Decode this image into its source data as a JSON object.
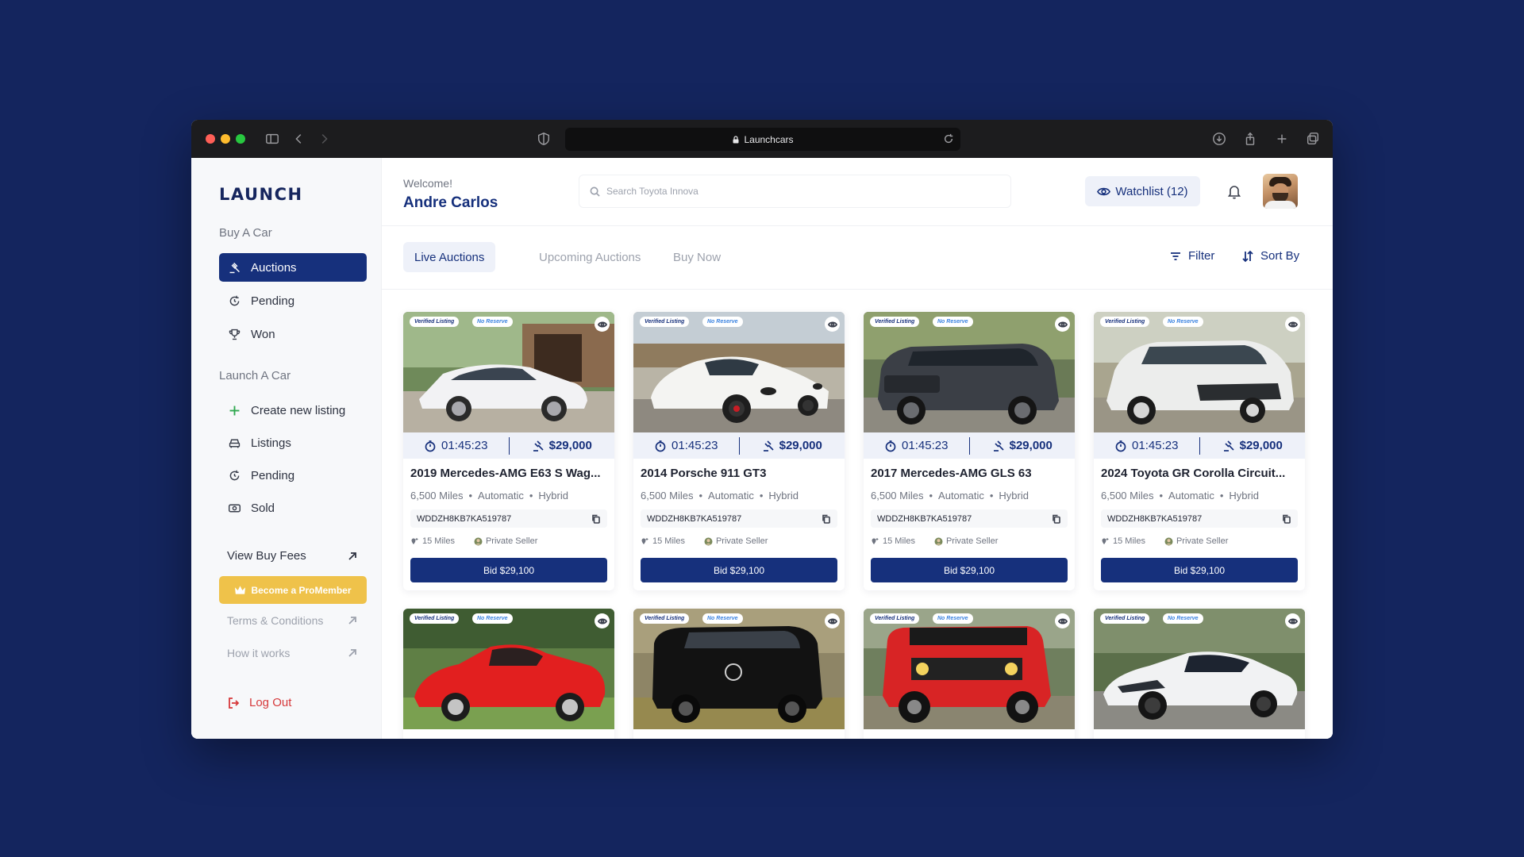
{
  "browser": {
    "url_label": "Launchcars"
  },
  "sidebar": {
    "logo": "LAUNCH",
    "section_buy": "Buy A Car",
    "buy_items": [
      {
        "label": "Auctions",
        "icon": "gavel-icon",
        "active": true
      },
      {
        "label": "Pending",
        "icon": "refresh-icon"
      },
      {
        "label": "Won",
        "icon": "trophy-icon"
      }
    ],
    "section_launch": "Launch A Car",
    "launch_items": [
      {
        "label": "Create new listing",
        "icon": "plus-icon"
      },
      {
        "label": "Listings",
        "icon": "car-icon"
      },
      {
        "label": "Pending",
        "icon": "refresh-icon"
      },
      {
        "label": "Sold",
        "icon": "cash-icon"
      }
    ],
    "view_buy_fees": "View Buy Fees",
    "pro_member": "Become a ProMember",
    "terms": "Terms & Conditions",
    "how_it_works": "How it works",
    "logout": "Log Out"
  },
  "header": {
    "welcome": "Welcome!",
    "username": "Andre Carlos",
    "search_placeholder": "Search Toyota Innova",
    "watchlist": "Watchlist (12)"
  },
  "tabs": [
    {
      "label": "Live Auctions",
      "active": true
    },
    {
      "label": "Upcoming Auctions"
    },
    {
      "label": "Buy Now"
    }
  ],
  "tools": {
    "filter": "Filter",
    "sort": "Sort By"
  },
  "badges": {
    "verified": "Verified Listing",
    "no_reserve": "No Reserve"
  },
  "listings": [
    {
      "title": "2019 Mercedes-AMG E63 S Wag...",
      "timer": "01:45:23",
      "price": "$29,000",
      "miles": "6,500 Miles",
      "transmission": "Automatic",
      "fuel": "Hybrid",
      "vin": "WDDZH8KB7KA519787",
      "distance": "15 Miles",
      "seller": "Private Seller",
      "bid": "Bid $29,100"
    },
    {
      "title": "2014 Porsche 911 GT3",
      "timer": "01:45:23",
      "price": "$29,000",
      "miles": "6,500 Miles",
      "transmission": "Automatic",
      "fuel": "Hybrid",
      "vin": "WDDZH8KB7KA519787",
      "distance": "15 Miles",
      "seller": "Private Seller",
      "bid": "Bid $29,100"
    },
    {
      "title": "2017 Mercedes-AMG GLS 63",
      "timer": "01:45:23",
      "price": "$29,000",
      "miles": "6,500 Miles",
      "transmission": "Automatic",
      "fuel": "Hybrid",
      "vin": "WDDZH8KB7KA519787",
      "distance": "15 Miles",
      "seller": "Private Seller",
      "bid": "Bid $29,100"
    },
    {
      "title": "2024 Toyota GR Corolla Circuit...",
      "timer": "01:45:23",
      "price": "$29,000",
      "miles": "6,500 Miles",
      "transmission": "Automatic",
      "fuel": "Hybrid",
      "vin": "WDDZH8KB7KA519787",
      "distance": "15 Miles",
      "seller": "Private Seller",
      "bid": "Bid $29,100"
    }
  ],
  "colors": {
    "background": "#14255e",
    "primary": "#16307c",
    "accent_gold": "#efc24a",
    "logout_red": "#d6393b"
  }
}
